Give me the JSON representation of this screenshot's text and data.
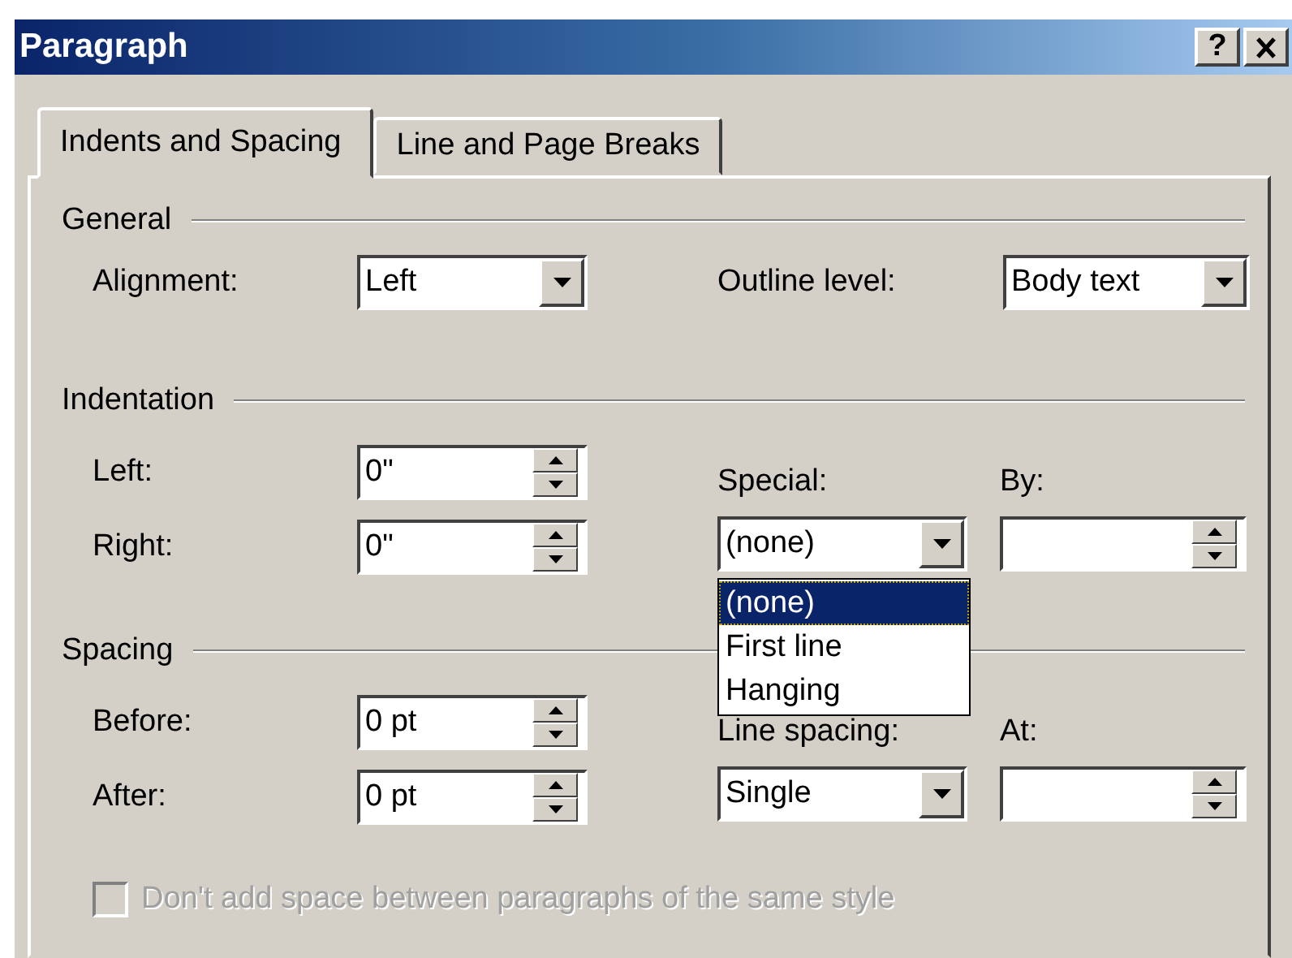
{
  "window": {
    "title": "Paragraph",
    "title_buttons": [
      {
        "kind": "help",
        "label": "?"
      },
      {
        "kind": "close"
      }
    ]
  },
  "tabs": [
    {
      "label": "Indents and Spacing",
      "selected": true
    },
    {
      "label": "Line and Page Breaks",
      "selected": false
    }
  ],
  "sections": [
    {
      "title": "General",
      "kind": "inline",
      "left": [
        {
          "label": "Alignment:",
          "kind": "combo",
          "value": "Left"
        }
      ],
      "right": [
        {
          "label": "Outline level:",
          "kind": "combo",
          "value": "Body text"
        }
      ]
    },
    {
      "title": "Indentation",
      "kind": "paired",
      "left": [
        {
          "label": "Left:",
          "kind": "spin",
          "value": "0\""
        },
        {
          "label": "Right:",
          "kind": "spin",
          "value": "0\""
        }
      ],
      "right": [
        {
          "label": "Special:",
          "kind": "combo",
          "value": "(none)",
          "open_list": [
            {
              "label": "(none)",
              "selected": true
            },
            {
              "label": "First line",
              "selected": false
            },
            {
              "label": "Hanging",
              "selected": false
            }
          ]
        },
        {
          "label": "By:",
          "kind": "spin"
        }
      ]
    },
    {
      "title": "Spacing",
      "kind": "paired",
      "left": [
        {
          "label": "Before:",
          "kind": "spin",
          "value": "0 pt"
        },
        {
          "label": "After:",
          "kind": "spin",
          "value": "0 pt"
        }
      ],
      "right": [
        {
          "label": "Line spacing:",
          "kind": "combo",
          "value": "Single"
        },
        {
          "label": "At:",
          "kind": "spin"
        }
      ]
    }
  ],
  "checkbox": {
    "label": "Don't add space between paragraphs of the same style",
    "checked": false,
    "disabled": true
  }
}
